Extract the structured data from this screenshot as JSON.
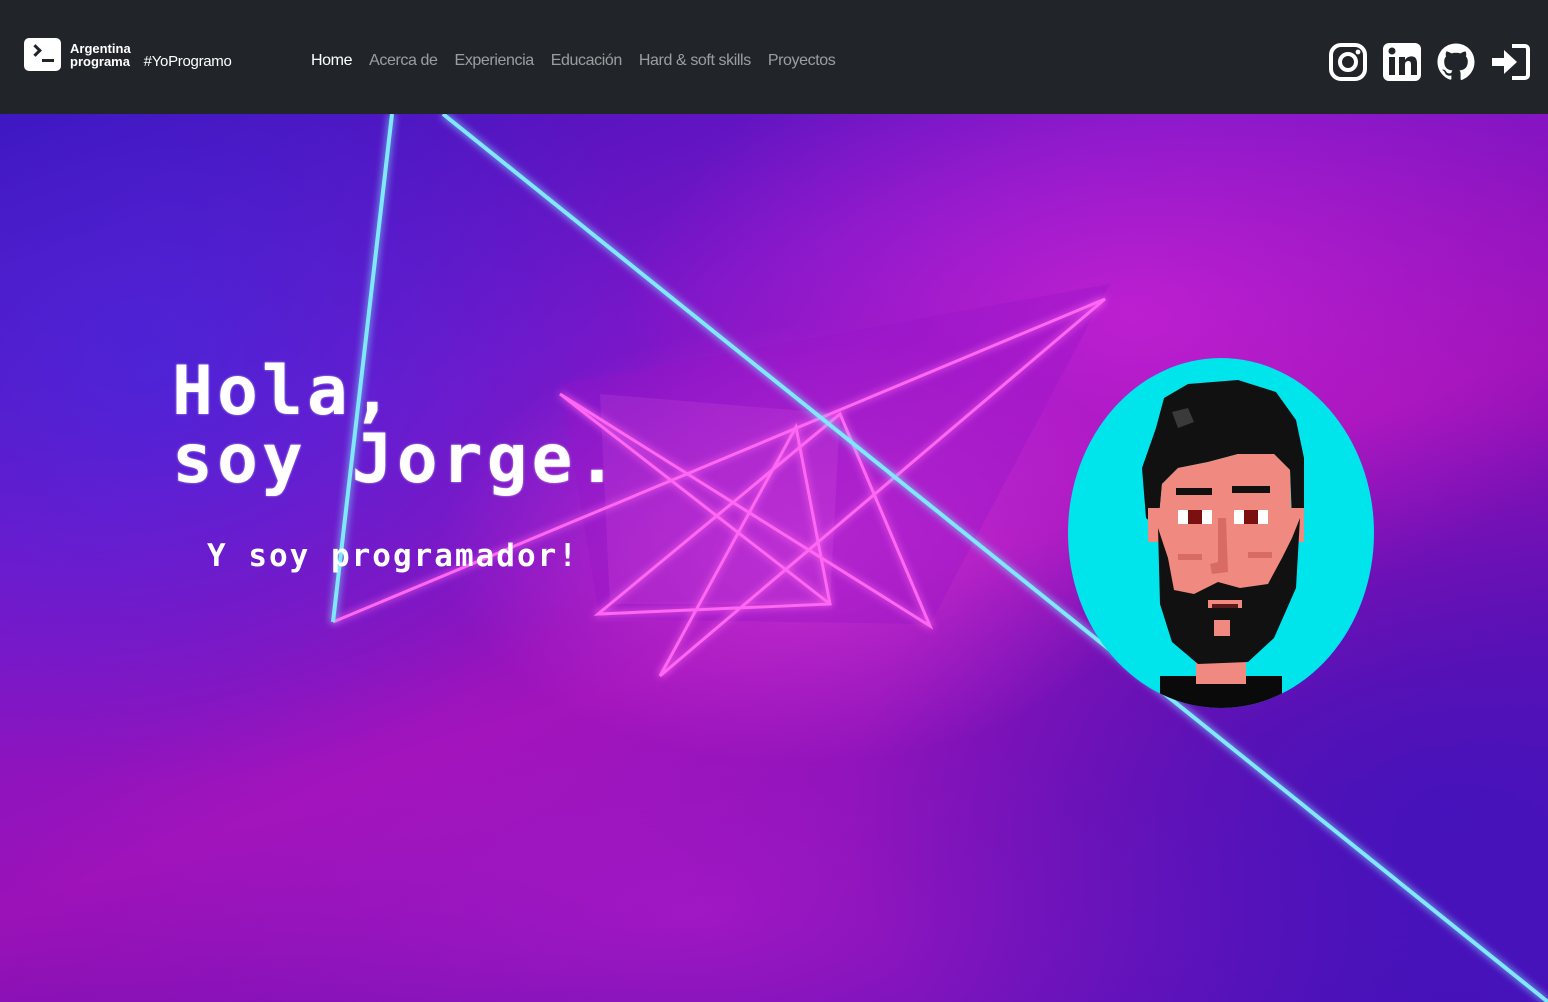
{
  "brand": {
    "name_line1": "Argentina",
    "name_line2": "programa",
    "tag": "#YoProgramo"
  },
  "nav": {
    "items": [
      {
        "label": "Home",
        "active": true
      },
      {
        "label": "Acerca de",
        "active": false
      },
      {
        "label": "Experiencia",
        "active": false
      },
      {
        "label": "Educación",
        "active": false
      },
      {
        "label": "Hard & soft skills",
        "active": false
      },
      {
        "label": "Proyectos",
        "active": false
      }
    ]
  },
  "socials": [
    {
      "icon": "instagram-icon"
    },
    {
      "icon": "linkedin-icon"
    },
    {
      "icon": "github-icon"
    },
    {
      "icon": "login-icon"
    }
  ],
  "hero": {
    "title_line1": "Hola,",
    "title_line2": "soy Jorge.",
    "subtitle": "Y soy programador!",
    "avatar_bg": "#00e4ec"
  },
  "colors": {
    "navbar": "#212529",
    "nav_active": "#ffffff",
    "nav_inactive": "rgba(255,255,255,0.55)",
    "laser_cyan": "#7fe8ff",
    "laser_pink": "#ff66f2"
  }
}
